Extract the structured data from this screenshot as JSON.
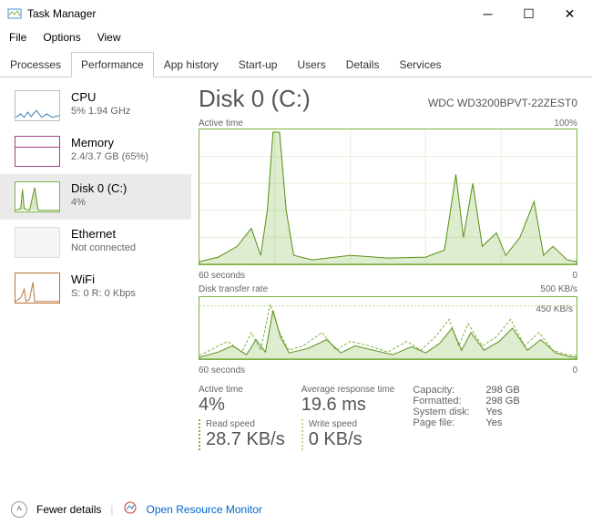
{
  "window": {
    "title": "Task Manager"
  },
  "menu": {
    "file": "File",
    "options": "Options",
    "view": "View"
  },
  "tabs": {
    "processes": "Processes",
    "performance": "Performance",
    "apphistory": "App history",
    "startup": "Start-up",
    "users": "Users",
    "details": "Details",
    "services": "Services"
  },
  "sidebar": {
    "cpu": {
      "name": "CPU",
      "sub": "5%  1.94 GHz"
    },
    "memory": {
      "name": "Memory",
      "sub": "2.4/3.7 GB (65%)"
    },
    "disk": {
      "name": "Disk 0 (C:)",
      "sub": "4%"
    },
    "ethernet": {
      "name": "Ethernet",
      "sub": "Not connected"
    },
    "wifi": {
      "name": "WiFi",
      "sub": "S: 0 R: 0 Kbps"
    }
  },
  "main": {
    "title": "Disk 0 (C:)",
    "model": "WDC WD3200BPVT-22ZEST0",
    "chart1": {
      "label": "Active time",
      "max": "100%",
      "axis_l": "60 seconds",
      "axis_r": "0"
    },
    "chart2": {
      "label": "Disk transfer rate",
      "max": "500 KB/s",
      "key": "450 KB/s",
      "axis_l": "60 seconds",
      "axis_r": "0"
    },
    "stats": {
      "active_time": {
        "label": "Active time",
        "value": "4%"
      },
      "avg_resp": {
        "label": "Average response time",
        "value": "19.6 ms"
      },
      "read": {
        "label": "Read speed",
        "value": "28.7 KB/s"
      },
      "write": {
        "label": "Write speed",
        "value": "0 KB/s"
      }
    },
    "props": {
      "capacity": {
        "k": "Capacity:",
        "v": "298 GB"
      },
      "formatted": {
        "k": "Formatted:",
        "v": "298 GB"
      },
      "system": {
        "k": "System disk:",
        "v": "Yes"
      },
      "page": {
        "k": "Page file:",
        "v": "Yes"
      }
    }
  },
  "footer": {
    "fewer": "Fewer details",
    "monitor": "Open Resource Monitor"
  },
  "chart_data": [
    {
      "type": "area",
      "title": "Active time",
      "x": "60 seconds ago → 0",
      "ylim": [
        0,
        100
      ],
      "ylabel": "%",
      "values_pct": [
        2,
        4,
        3,
        2,
        12,
        8,
        5,
        40,
        20,
        6,
        4,
        100,
        40,
        6,
        3,
        2,
        8,
        5,
        3,
        4,
        6,
        5,
        4,
        3,
        5,
        4,
        6,
        5,
        4,
        3,
        4,
        5,
        6,
        8,
        6,
        4,
        5,
        3,
        4,
        12,
        70,
        30,
        10,
        14,
        60,
        18,
        10,
        8,
        12,
        8,
        10,
        25,
        15,
        45,
        20,
        10,
        5,
        3,
        4,
        2
      ],
      "color": "#7cb342"
    },
    {
      "type": "area",
      "title": "Disk transfer rate",
      "x": "60 seconds ago → 0",
      "ylim": [
        0,
        500
      ],
      "ylabel": "KB/s",
      "series": [
        {
          "name": "read (dashed)",
          "values_kbps": [
            10,
            30,
            20,
            10,
            60,
            30,
            20,
            200,
            100,
            40,
            20,
            450,
            300,
            60,
            30,
            20,
            80,
            40,
            30,
            100,
            120,
            80,
            50,
            40,
            100,
            80,
            60,
            40,
            30,
            20,
            80,
            60,
            100,
            120,
            80,
            40,
            30,
            50,
            80,
            100,
            250,
            150,
            80,
            120,
            300,
            160,
            90,
            70,
            120,
            100,
            90,
            200,
            150,
            300,
            180,
            120,
            60,
            40,
            30,
            20
          ]
        },
        {
          "name": "write (solid)",
          "values_kbps": [
            5,
            10,
            8,
            5,
            30,
            15,
            10,
            100,
            60,
            20,
            10,
            380,
            200,
            30,
            15,
            10,
            40,
            20,
            15,
            40,
            60,
            40,
            25,
            20,
            50,
            40,
            30,
            20,
            15,
            10,
            40,
            30,
            50,
            70,
            40,
            20,
            15,
            25,
            40,
            60,
            180,
            100,
            50,
            70,
            200,
            110,
            60,
            40,
            70,
            60,
            50,
            150,
            100,
            220,
            130,
            80,
            40,
            25,
            20,
            10
          ]
        }
      ],
      "marker_line": 450,
      "color": "#7cb342"
    }
  ]
}
